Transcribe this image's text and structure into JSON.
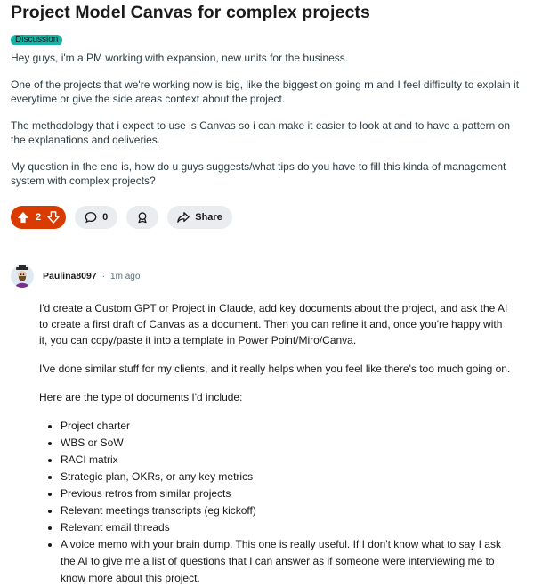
{
  "post": {
    "title": "Project Model Canvas for complex projects",
    "flair": "Discussion",
    "paragraphs": [
      "Hey guys, i'm a PM working with expansion, new units for the business.",
      "One of the projects that we're working now is big, like the biggest on going rn and I feel difficulty to explain it everytime or give the side areas context about the project.",
      "The methodology that i expect to use is Canvas so i can make it easier to look at and to have a pattern on the explanations and deliveries.",
      "My question in the end is, how do u guys suggests/what tips do you have to fill this kinda of management system with complex projects?"
    ],
    "actions": {
      "vote_count": "2",
      "comment_count": "0",
      "share_label": "Share"
    }
  },
  "comment": {
    "username": "Paulina8097",
    "separator": "·",
    "time": "1m ago",
    "paragraphs": [
      "I'd create a Custom GPT or Project in Claude, add key documents about the project, and ask the AI to create a first draft of Canvas as a document. Then you can refine it and, once you're happy with it, you can copy/paste it into a template in Power Point/Miro/Canva.",
      "I've done similar stuff for my clients, and it really helps when you feel like there's too much going on.",
      "Here are the type of documents I'd include:"
    ],
    "list": [
      "Project charter",
      "WBS or SoW",
      "RACI matrix",
      "Strategic plan, OKRs, or any key metrics",
      "Previous retros from similar projects",
      "Relevant meetings transcripts (eg kickoff)",
      "Relevant email threads",
      "A voice memo with your brain dump. This one is really useful. If I don't know what to say I ask the AI to give me a list of questions that I can answer as if someone were interviewing me to know more about this project."
    ]
  },
  "colors": {
    "flair": "#14b3a3",
    "vote_active": "#d93a00",
    "pill_bg": "#eaedef"
  }
}
